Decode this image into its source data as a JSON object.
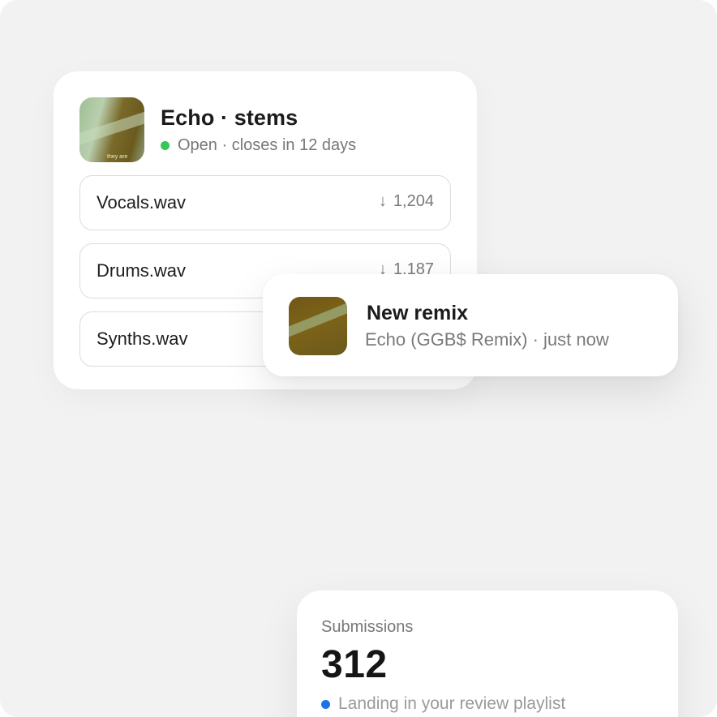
{
  "stems": {
    "title": "Echo · stems",
    "status": "Open · closes in 12 days",
    "status_color": "#34c759",
    "art_text": "they are",
    "files": [
      {
        "name": "Vocals.wav",
        "count": "1,204"
      },
      {
        "name": "Drums.wav",
        "count": "1,187"
      },
      {
        "name": "Synths.wav",
        "count": ""
      }
    ]
  },
  "notification": {
    "title": "New remix",
    "subtitle": "Echo (GGB$ Remix) · just now"
  },
  "submissions": {
    "label": "Submissions",
    "value": "312",
    "note": "Landing in your review playlist",
    "note_color": "#1a73e8"
  },
  "icons": {
    "download": "download-arrow-icon",
    "status_dot": "status-dot-icon"
  }
}
